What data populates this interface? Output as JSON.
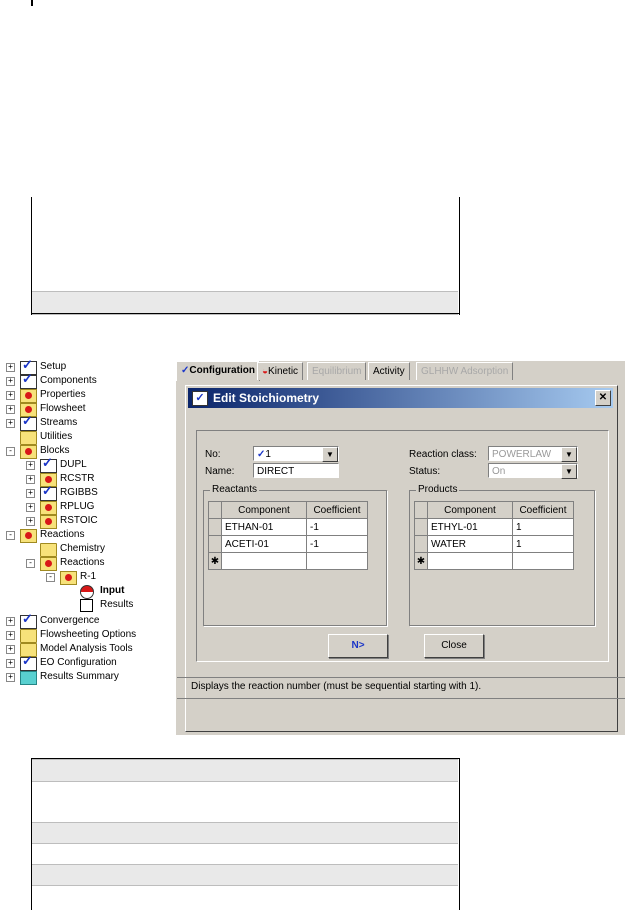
{
  "tree": {
    "items": [
      {
        "label": "Setup",
        "icon": "check-icon"
      },
      {
        "label": "Components",
        "icon": "check-icon"
      },
      {
        "label": "Properties",
        "icon": "red-folder-icon"
      },
      {
        "label": "Flowsheet",
        "icon": "red-folder-icon"
      },
      {
        "label": "Streams",
        "icon": "check-icon"
      },
      {
        "label": "Utilities",
        "icon": "folder-icon"
      },
      {
        "label": "Blocks",
        "icon": "red-folder-icon"
      },
      {
        "label": "DUPL",
        "icon": "check-icon"
      },
      {
        "label": "RCSTR",
        "icon": "red-folder-icon"
      },
      {
        "label": "RGIBBS",
        "icon": "check-icon"
      },
      {
        "label": "RPLUG",
        "icon": "red-folder-icon"
      },
      {
        "label": "RSTOIC",
        "icon": "red-folder-icon"
      },
      {
        "label": "Reactions",
        "icon": "red-folder-icon"
      },
      {
        "label": "Chemistry",
        "icon": "folder-icon"
      },
      {
        "label": "Reactions",
        "icon": "red-folder-icon"
      },
      {
        "label": "R-1",
        "icon": "red-folder-icon"
      },
      {
        "label": "Input",
        "icon": "half-red-circle-icon"
      },
      {
        "label": "Results",
        "icon": "empty-square-icon"
      },
      {
        "label": "Convergence",
        "icon": "check-icon"
      },
      {
        "label": "Flowsheeting Options",
        "icon": "folder-icon"
      },
      {
        "label": "Model Analysis Tools",
        "icon": "folder-icon"
      },
      {
        "label": "EO Configuration",
        "icon": "check-icon"
      },
      {
        "label": "Results Summary",
        "icon": "cyan-folder-icon"
      }
    ]
  },
  "tabs": [
    {
      "label": "Configuration",
      "state": "active"
    },
    {
      "label": "Kinetic",
      "state": "normal"
    },
    {
      "label": "Equilibrium",
      "state": "disabled"
    },
    {
      "label": "Activity",
      "state": "normal"
    },
    {
      "label": "GLHHW Adsorption",
      "state": "disabled"
    }
  ],
  "dialog": {
    "title": "Edit Stoichiometry",
    "close_glyph": "✕",
    "no_label": "No:",
    "no_value": "1",
    "name_label": "Name:",
    "name_value": "DIRECT",
    "reaction_class_label": "Reaction class:",
    "reaction_class_value": "POWERLAW",
    "status_label": "Status:",
    "status_value": "On",
    "reactants": {
      "title": "Reactants",
      "headers": [
        "Component",
        "Coefficient"
      ],
      "rows": [
        [
          "ETHAN-01",
          "-1"
        ],
        [
          "ACETI-01",
          "-1"
        ]
      ],
      "new_row_marker": "✱"
    },
    "products": {
      "title": "Products",
      "headers": [
        "Component",
        "Coefficient"
      ],
      "rows": [
        [
          "ETHYL-01",
          "1"
        ],
        [
          "WATER",
          "1"
        ]
      ],
      "new_row_marker": "✱"
    },
    "next_button": "N>",
    "close_button": "Close",
    "status_text": "Displays the reaction number (must be sequential starting with 1)."
  },
  "colors": {
    "accent": "#0a246a",
    "next_arrow": "#1a35c8",
    "error_red": "#d81818"
  }
}
